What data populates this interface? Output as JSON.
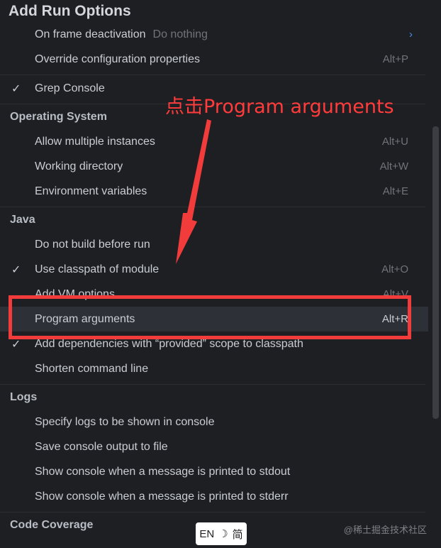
{
  "title": "Add Run Options",
  "rows": [
    {
      "label": "On frame deactivation",
      "sub": "Do nothing",
      "shortcut": "",
      "checked": false,
      "chevron": "›"
    },
    {
      "label": "Override configuration properties",
      "sub": "",
      "shortcut": "Alt+P",
      "checked": false
    },
    {
      "label": "Grep Console",
      "sub": "",
      "shortcut": "",
      "checked": true
    },
    {
      "label": "Allow multiple instances",
      "sub": "",
      "shortcut": "Alt+U",
      "checked": false
    },
    {
      "label": "Working directory",
      "sub": "",
      "shortcut": "Alt+W",
      "checked": false
    },
    {
      "label": "Environment variables",
      "sub": "",
      "shortcut": "Alt+E",
      "checked": false
    },
    {
      "label": "Do not build before run",
      "sub": "",
      "shortcut": "",
      "checked": false
    },
    {
      "label": "Use classpath of module",
      "sub": "",
      "shortcut": "Alt+O",
      "checked": true
    },
    {
      "label": "Add VM options",
      "sub": "",
      "shortcut": "Alt+V",
      "checked": false
    },
    {
      "label": "Program arguments",
      "sub": "",
      "shortcut": "Alt+R",
      "checked": false,
      "selected": true
    },
    {
      "label": "Add dependencies with “provided” scope to classpath",
      "sub": "",
      "shortcut": "",
      "checked": true
    },
    {
      "label": "Shorten command line",
      "sub": "",
      "shortcut": "",
      "checked": false
    },
    {
      "label": "Specify logs to be shown in console",
      "sub": "",
      "shortcut": "",
      "checked": false
    },
    {
      "label": "Save console output to file",
      "sub": "",
      "shortcut": "",
      "checked": false
    },
    {
      "label": "Show console when a message is printed to stdout",
      "sub": "",
      "shortcut": "",
      "checked": false
    },
    {
      "label": "Show console when a message is printed to stderr",
      "sub": "",
      "shortcut": "",
      "checked": false
    }
  ],
  "sections": {
    "os": "Operating System",
    "java": "Java",
    "logs": "Logs",
    "coverage": "Code Coverage"
  },
  "check_glyph": "✓",
  "annotation": "点击Program arguments",
  "ime": {
    "lang": "EN",
    "mode": "简"
  },
  "watermark": "@稀土掘金技术社区",
  "colors": {
    "background": "#1e1f22",
    "selected": "#2e3037",
    "annotation": "#f23c3c",
    "accent": "#4a8fe7"
  }
}
